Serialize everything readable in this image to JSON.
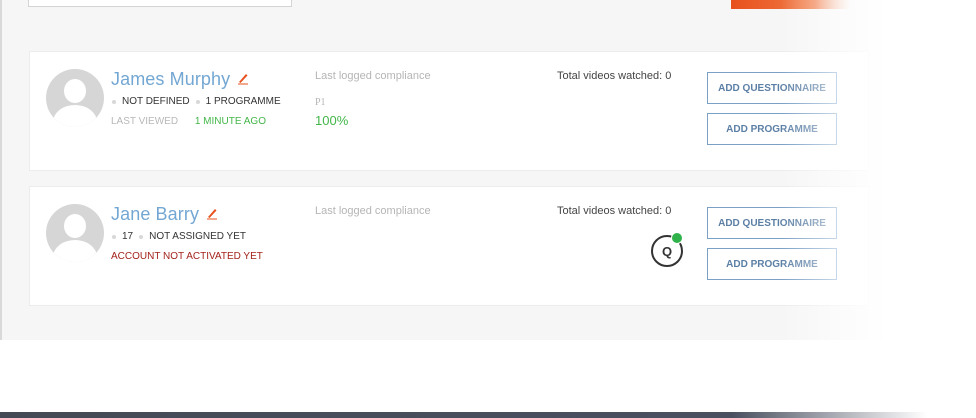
{
  "cards": [
    {
      "name": "James Murphy",
      "meta": [
        "NOT DEFINED",
        "1 PROGRAMME"
      ],
      "last_viewed_label": "LAST VIEWED",
      "last_viewed_value": "1 MINUTE AGO",
      "compliance_label": "Last logged compliance",
      "compliance_code": "P1",
      "compliance_pct": "100%",
      "videos": "Total videos watched: 0",
      "btn_questionnaire": "ADD QUESTIONNAIRE",
      "btn_programme": "ADD PROGRAMME"
    },
    {
      "name": "Jane Barry",
      "meta": [
        "17",
        "NOT ASSIGNED YET"
      ],
      "status": "ACCOUNT NOT ACTIVATED YET",
      "compliance_label": "Last logged compliance",
      "videos": "Total videos watched: 0",
      "q_badge": "Q",
      "btn_questionnaire": "ADD QUESTIONNAIRE",
      "btn_programme": "ADD PROGRAMME"
    }
  ],
  "colors": {
    "name": "#73a7d3",
    "accent": "#e8501e",
    "success": "#43b649",
    "error": "#a3221b",
    "button_border": "#7aa0c6"
  },
  "icons": {
    "edit": "pencil-icon",
    "avatar": "user-avatar-placeholder",
    "status": "green-dot-icon"
  }
}
